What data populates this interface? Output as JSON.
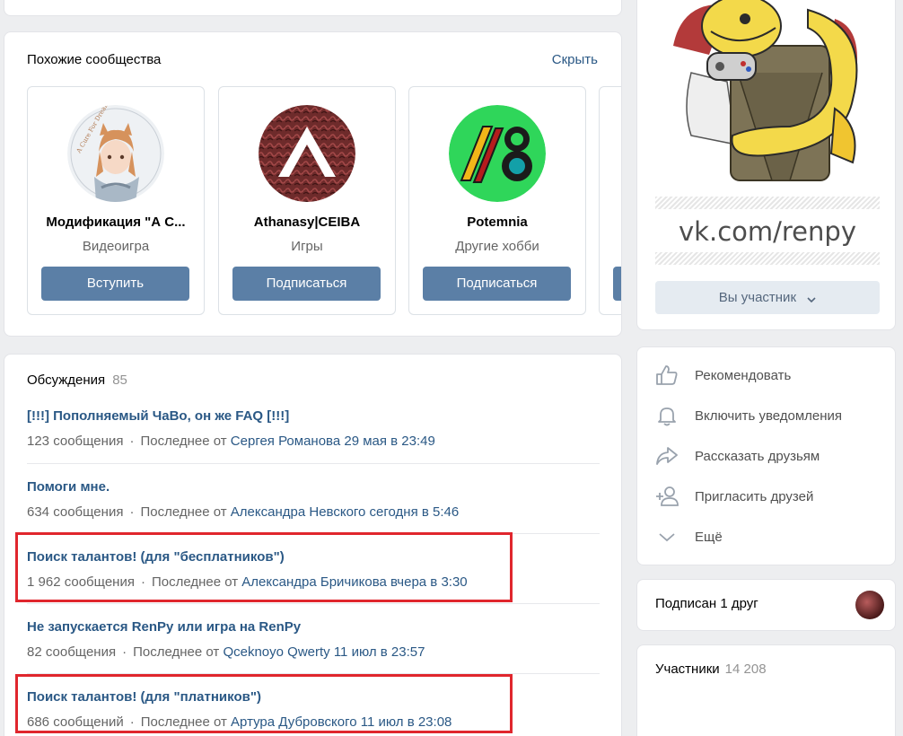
{
  "similar": {
    "title": "Похожие сообщества",
    "hide_label": "Скрыть",
    "cards": [
      {
        "name": "Модификация \"А С...",
        "category": "Видеоигра",
        "button": "Вступить"
      },
      {
        "name": "Athanasy|CEIBA",
        "category": "Игры",
        "button": "Подписаться"
      },
      {
        "name": "Potemnia",
        "category": "Другие хобби",
        "button": "Подписаться"
      }
    ],
    "avatar_text_1": "A Cure For Dreams"
  },
  "discussions": {
    "title": "Обсуждения",
    "count": "85",
    "last_from": "Последнее от",
    "topics": [
      {
        "title": "[!!!] Пополняемый ЧаВо, он же FAQ [!!!]",
        "messages": "123 сообщения",
        "author_time": "Сергея Романова 29 мая в 23:49"
      },
      {
        "title": "Помоги мне.",
        "messages": "634 сообщения",
        "author_time": "Александра Невского сегодня в 5:46"
      },
      {
        "title": "Поиск талантов! (для \"бесплатников\")",
        "messages": "1 962 сообщения",
        "author_time": "Александра Бричикова вчера в 3:30"
      },
      {
        "title": "Не запускается RenPy или игра на RenPy",
        "messages": "82 сообщения",
        "author_time": "Qceknoyo Qwerty 11 июл в 23:57"
      },
      {
        "title": "Поиск талантов! (для \"платников\")",
        "messages": "686 сообщений",
        "author_time": "Артура Дубровского 11 июл в 23:08"
      }
    ]
  },
  "cover": {
    "url_text": "vk.com/renpy",
    "member_button": "Вы участник"
  },
  "actions": [
    {
      "label": "Рекомендовать",
      "icon": "thumbs-up-icon"
    },
    {
      "label": "Включить уведомления",
      "icon": "bell-icon"
    },
    {
      "label": "Рассказать друзьям",
      "icon": "share-icon"
    },
    {
      "label": "Пригласить друзей",
      "icon": "add-user-icon"
    },
    {
      "label": "Ещё",
      "icon": "chevron-down-icon"
    }
  ],
  "friends": {
    "text": "Подписан 1 друг"
  },
  "members": {
    "title": "Участники",
    "count": "14 208"
  },
  "colors": {
    "link": "#2a5885",
    "button": "#5b7fa6",
    "highlight": "#e0262d",
    "background": "#edeef0"
  }
}
